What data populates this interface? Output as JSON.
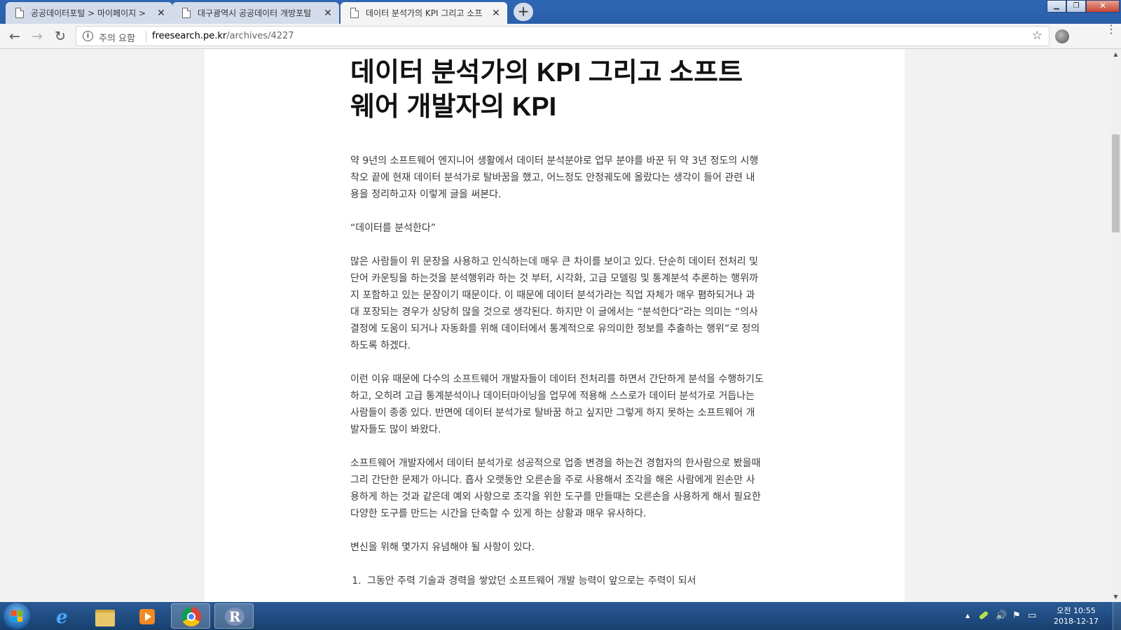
{
  "browser": {
    "tabs": [
      {
        "title": "공공데이터포털 > 마이페이지 > "
      },
      {
        "title": "대구광역시 공공데이터 개방포털"
      },
      {
        "title": "데이터 분석가의 KPI 그리고 소프"
      }
    ],
    "new_tab_label": "+",
    "window_controls": {
      "minimize": "▁",
      "maximize": "❐",
      "close": "✕"
    },
    "nav": {
      "back": "←",
      "forward": "→",
      "reload": "↻"
    },
    "address": {
      "security_label": "주의 요함",
      "host": "freesearch.pe.kr",
      "path": "/archives/4227"
    },
    "icons": {
      "info": "info-icon",
      "star": "star-icon",
      "menu": "menu-icon",
      "extension": "extension-icon"
    }
  },
  "article": {
    "title": "데이터 분석가의 KPI 그리고 소프트웨어 개발자의 KPI",
    "paragraphs": [
      "약 9년의 소프트웨어 엔지니어 생활에서 데이터 분석분야로 업무 분야를 바꾼 뒤 약 3년 정도의 시행착오 끝에 현재 데이터 분석가로 탈바꿈을 했고, 어느정도 안정궤도에 올랐다는 생각이 들어 관련 내용을 정리하고자 이렇게 글을 써본다.",
      "“데이터를 분석한다”",
      "많은 사람들이 위 문장을 사용하고 인식하는데 매우 큰 차이를 보이고 있다. 단순히 데이터 전처리 및 단어 카운팅을 하는것을 분석행위라 하는 것 부터, 시각화, 고급 모델링 및 통계분석 추론하는 행위까지 포함하고 있는 문장이기 때문이다. 이 때문에 데이터 분석가라는 직업 자체가 매우 폄하되거나 과대 포장되는 경우가 상당히 많을 것으로 생각된다. 하지만 이 글에서는 “분석한다”라는 의미는 “의사결정에 도움이 되거나 자동화를 위해 데이터에서 통계적으로 유의미한 정보를 추출하는 행위”로 정의하도록 하겠다.",
      "이런 이유 때문에 다수의 소프트웨어 개발자들이 데이터 전처리를 하면서 간단하게 분석을 수행하기도 하고, 오히려 고급 통계분석이나 데이터마이닝을 업무에 적용해 스스로가 데이터 분석가로 거듭나는 사람들이 종종 있다. 반면에 데이터 분석가로 탈바꿈 하고 싶지만 그렇게 하지 못하는 소프트웨어 개발자들도 많이 봐왔다.",
      "소프트웨어 개발자에서 데이터 분석가로 성공적으로 업종 변경을 하는건 경험자의 한사람으로 봤을때 그리 간단한 문제가 아니다. 흡사 오랫동안 오른손을 주로 사용해서 조각을 해온 사람에게 왼손만 사용하게 하는 것과 같은데 예외 사항으로 조각을 위한 도구를 만들때는 오른손을 사용하게 해서 필요한 다양한 도구를 만드는 시간을 단축할 수 있게 하는 상황과 매우 유사하다.",
      "변신을 위해 몇가지 유념해야 될 사항이 있다."
    ],
    "list": [
      "그동안 주력 기술과 경력을 쌓았던 소프트웨어 개발 능력이 앞으로는 주력이 되서"
    ]
  },
  "taskbar": {
    "apps": [
      "internet-explorer",
      "file-explorer",
      "media-player",
      "chrome",
      "r"
    ],
    "r_label": "R",
    "ie_label": "e",
    "clock": {
      "time": "오전 10:55",
      "date": "2018-12-17"
    },
    "tray": {
      "up_arrow": "▲",
      "volume": "🔊",
      "flag": "⚑",
      "network": "▭"
    }
  }
}
